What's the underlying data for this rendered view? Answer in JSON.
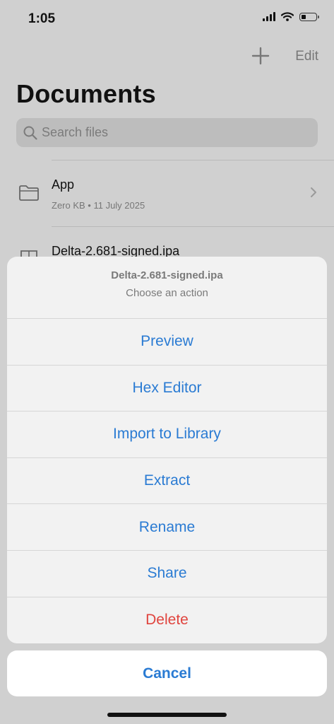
{
  "status_bar": {
    "time": "1:05",
    "icons": [
      "signal-icon",
      "wifi-icon",
      "battery-icon"
    ]
  },
  "nav": {
    "add_icon": "plus-icon",
    "edit_label": "Edit",
    "title": "Documents"
  },
  "search": {
    "icon": "search-icon",
    "placeholder": "Search files"
  },
  "files": [
    {
      "name": "App",
      "meta": "Zero KB • 11 July 2025",
      "icon": "folder-icon"
    },
    {
      "name": "Delta-2.681-signed.ipa",
      "icon": "archive-icon"
    }
  ],
  "action_sheet": {
    "title": "Delta-2.681-signed.ipa",
    "subtitle": "Choose an action",
    "actions": [
      {
        "label": "Preview"
      },
      {
        "label": "Hex Editor"
      },
      {
        "label": "Import to Library"
      },
      {
        "label": "Extract"
      },
      {
        "label": "Rename"
      },
      {
        "label": "Share"
      },
      {
        "label": "Delete",
        "style": "destructive"
      }
    ],
    "cancel_label": "Cancel"
  },
  "colors": {
    "accent": "#2a7bd3",
    "destructive": "#e0443e",
    "dim_background": "#d0d0d0"
  }
}
